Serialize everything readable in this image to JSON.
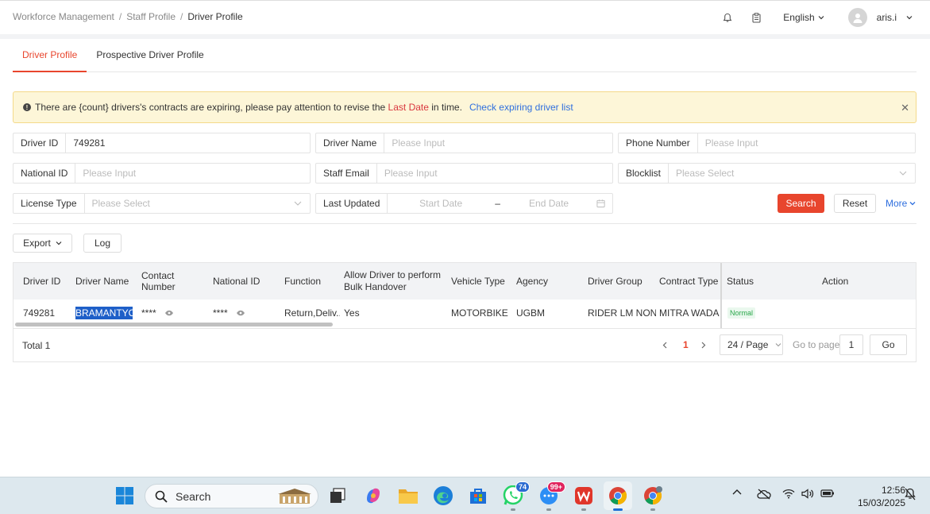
{
  "breadcrumb": [
    "Workforce Management",
    "Staff Profile",
    "Driver Profile"
  ],
  "header": {
    "language": "English",
    "user": "aris.i"
  },
  "tabs": [
    "Driver Profile",
    "Prospective Driver Profile"
  ],
  "alert": {
    "prefix": "There are {count} drivers's contracts are expiring, please pay attention to revise the",
    "highlight": "Last Date",
    "suffix": "in time.",
    "link": "Check expiring driver list"
  },
  "filters": {
    "driver_id": {
      "label": "Driver ID",
      "value": "749281"
    },
    "driver_name": {
      "label": "Driver Name",
      "placeholder": "Please Input"
    },
    "phone_number": {
      "label": "Phone Number",
      "placeholder": "Please Input"
    },
    "national_id": {
      "label": "National ID",
      "placeholder": "Please Input"
    },
    "staff_email": {
      "label": "Staff Email",
      "placeholder": "Please Input"
    },
    "blocklist": {
      "label": "Blocklist",
      "placeholder": "Please Select"
    },
    "license_type": {
      "label": "License Type",
      "placeholder": "Please Select"
    },
    "last_updated": {
      "label": "Last Updated",
      "start": "Start Date",
      "sep": "–",
      "end": "End Date"
    }
  },
  "actions": {
    "search": "Search",
    "reset": "Reset",
    "more": "More",
    "export": "Export",
    "log": "Log"
  },
  "table": {
    "headers": [
      "Driver ID",
      "Driver Name",
      "Contact Number",
      "National ID",
      "Function",
      "Allow Driver to perform Bulk Handover",
      "Vehicle Type",
      "Agency",
      "Driver Group",
      "Contract Type",
      "Status",
      "Action"
    ],
    "row": {
      "driver_id": "749281",
      "driver_name": "BRAMANTYO...",
      "contact_number": "****",
      "national_id": "****",
      "function": "Return,Deliv...",
      "bulk_handover": "Yes",
      "vehicle_type": "MOTORBIKE ...",
      "agency": "UGBM",
      "driver_group": "RIDER LM NON...",
      "contract_type": "MITRA WADA...",
      "status": "Normal"
    }
  },
  "pagination": {
    "total": "Total 1",
    "current_page": "1",
    "page_size": "24 / Page",
    "goto_label": "Go to page",
    "goto_value": "1",
    "go": "Go"
  },
  "taskbar": {
    "search": "Search",
    "whatsapp_badge": "74",
    "messenger_badge": "99+",
    "time": "12:56",
    "date": "15/03/2025"
  },
  "colors": {
    "accent": "#e8452d",
    "link": "#2f6fde",
    "alert_bg": "#fdf6d8",
    "status_green": "#2aa84a"
  }
}
